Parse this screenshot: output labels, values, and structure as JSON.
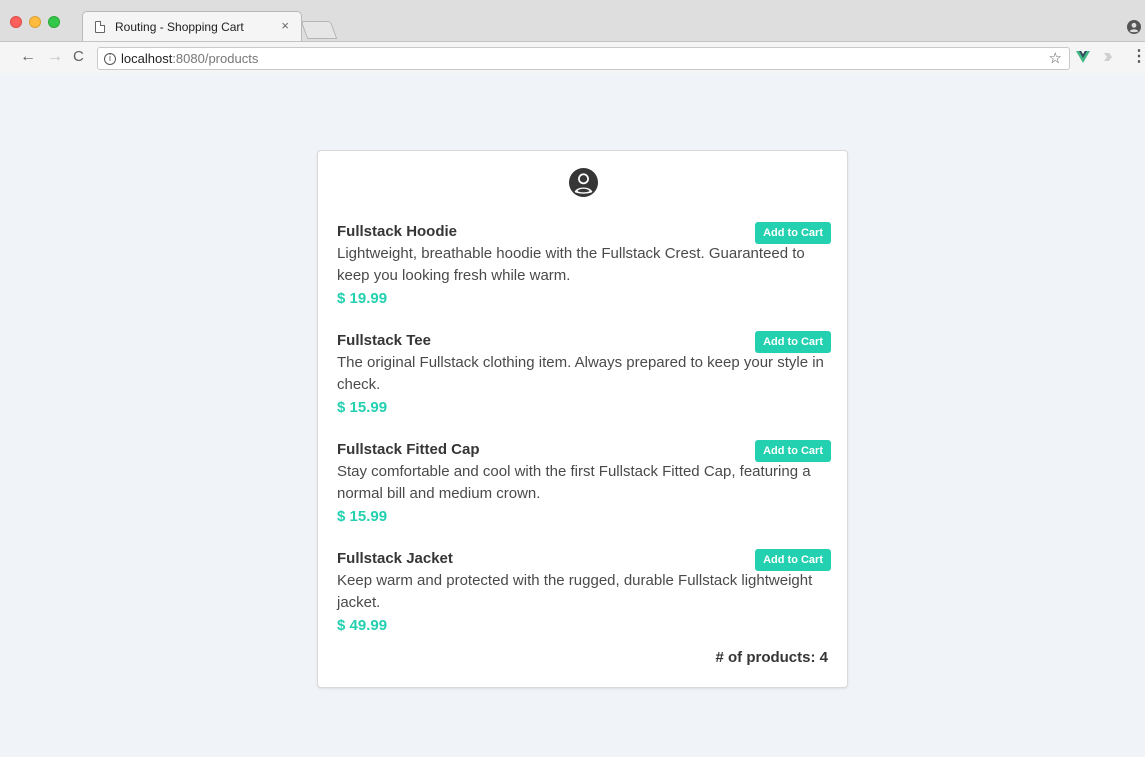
{
  "browser": {
    "tab_title": "Routing - Shopping Cart",
    "tab_close": "×",
    "url_host": "localhost",
    "url_path": ":8080/products",
    "info_glyph": "i",
    "star_glyph": "☆",
    "menu_glyph": "⋮",
    "back_glyph": "←",
    "forward_glyph": "→",
    "reload_glyph": "C"
  },
  "page": {
    "products": [
      {
        "name": "Fullstack Hoodie",
        "description": "Lightweight, breathable hoodie with the Fullstack Crest. Guaranteed to keep you looking fresh while warm.",
        "price": "$ 19.99",
        "button": "Add to Cart"
      },
      {
        "name": "Fullstack Tee",
        "description": "The original Fullstack clothing item. Always prepared to keep your style in check.",
        "price": "$ 15.99",
        "button": "Add to Cart"
      },
      {
        "name": "Fullstack Fitted Cap",
        "description": "Stay comfortable and cool with the first Fullstack Fitted Cap, featuring a normal bill and medium crown.",
        "price": "$ 15.99",
        "button": "Add to Cart"
      },
      {
        "name": "Fullstack Jacket",
        "description": "Keep warm and protected with the rugged, durable Fullstack lightweight jacket.",
        "price": "$ 49.99",
        "button": "Add to Cart"
      }
    ],
    "count_label": "# of products: 4"
  },
  "colors": {
    "accent": "#23d0b0",
    "background": "#f0f3f7"
  },
  "icons": {
    "user": "user-circle-icon",
    "page": "page-icon",
    "vue_extension": "vue-devtools-icon"
  }
}
